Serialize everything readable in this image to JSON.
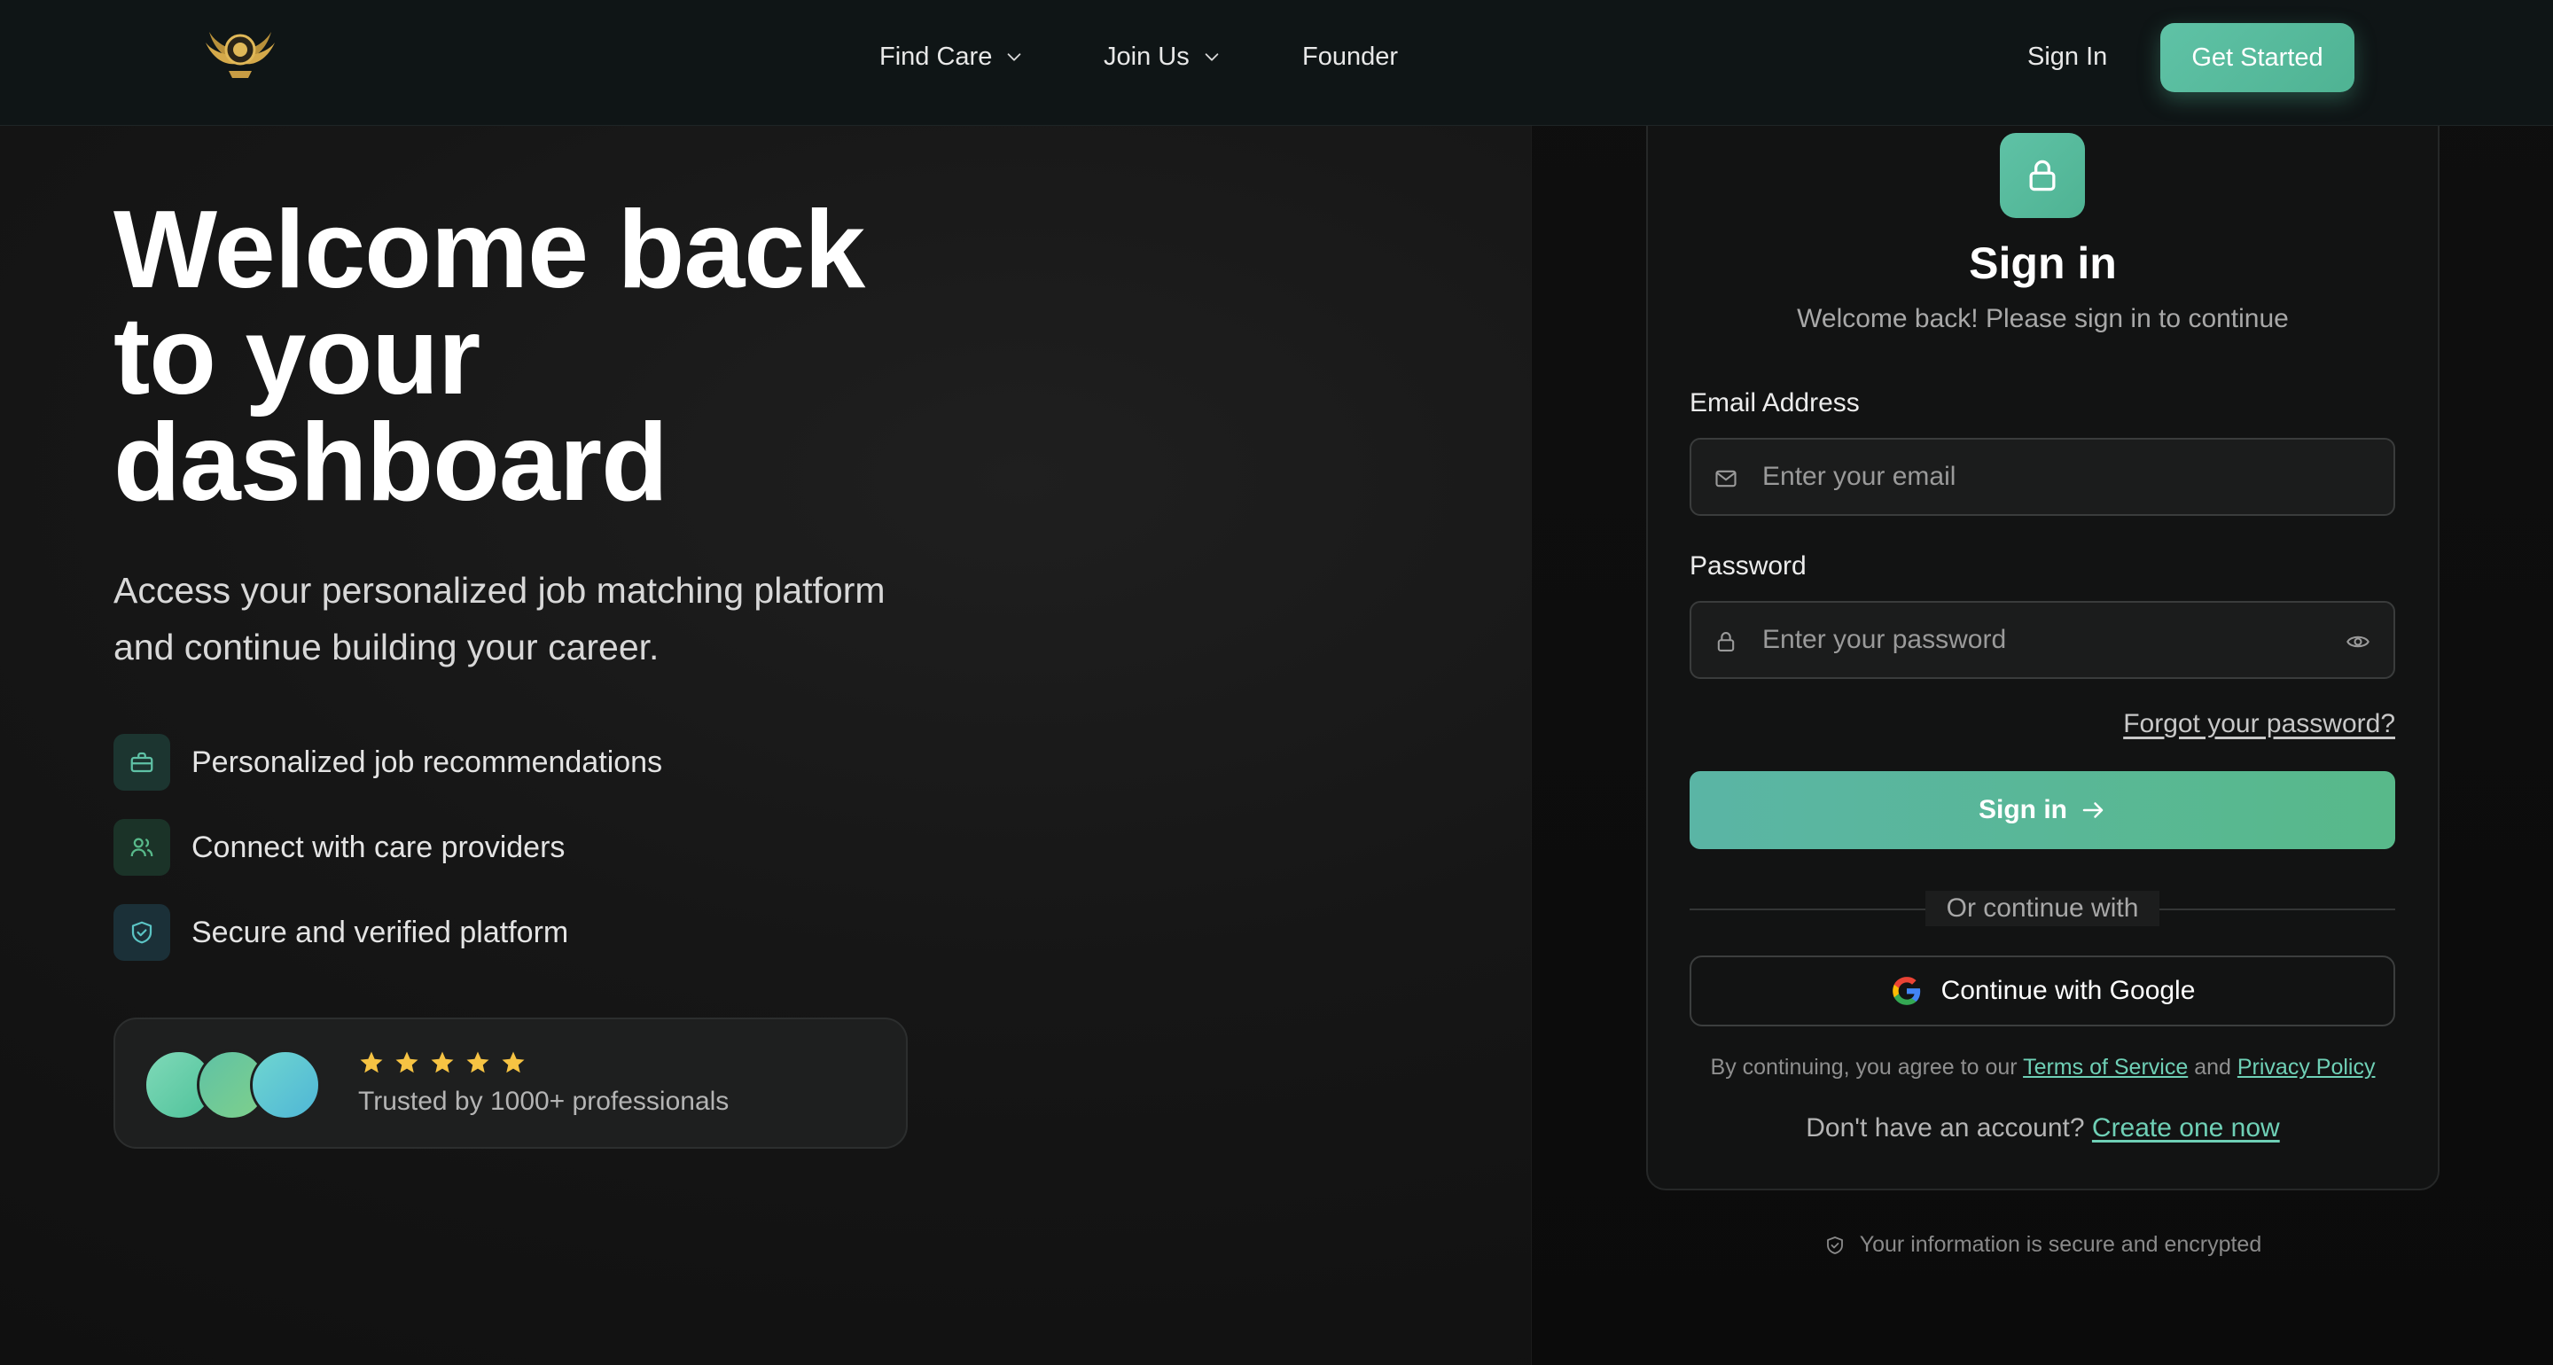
{
  "nav": {
    "links": [
      {
        "label": "Find Care",
        "has_dropdown": true
      },
      {
        "label": "Join Us",
        "has_dropdown": true
      },
      {
        "label": "Founder",
        "has_dropdown": false
      }
    ],
    "sign_in_label": "Sign In",
    "get_started_label": "Get Started",
    "logo_icon": "winged-emblem-icon"
  },
  "hero": {
    "title_lines": [
      "Welcome back",
      "to your",
      "dashboard"
    ],
    "subtitle": "Access your personalized job matching platform and continue building your career.",
    "features": [
      {
        "label": "Personalized job recommendations",
        "icon": "briefcase-icon"
      },
      {
        "label": "Connect with care providers",
        "icon": "users-icon"
      },
      {
        "label": "Secure and verified platform",
        "icon": "shield-check-icon"
      }
    ],
    "trust": {
      "rating": 5,
      "text": "Trusted by 1000+ professionals"
    }
  },
  "signin": {
    "icon": "lock-icon",
    "title": "Sign in",
    "subtitle": "Welcome back! Please sign in to continue",
    "email": {
      "label": "Email Address",
      "placeholder": "Enter your email",
      "value": ""
    },
    "password": {
      "label": "Password",
      "placeholder": "Enter your password",
      "value": ""
    },
    "forgot_label": "Forgot your password?",
    "submit_label": "Sign in",
    "divider_label": "Or continue with",
    "google_label": "Continue with Google",
    "terms": {
      "prefix": "By continuing, you agree to our",
      "tos_label": "Terms of Service",
      "and": "and",
      "privacy_label": "Privacy Policy"
    },
    "signup": {
      "prompt": "Don't have an account?",
      "link_label": "Create one now"
    }
  },
  "footer_note": "Your information is secure and encrypted",
  "colors": {
    "accent": "#5fc2a6",
    "accent_dark": "#4fb393",
    "star": "#f6c343",
    "link": "#6fd0b6"
  }
}
